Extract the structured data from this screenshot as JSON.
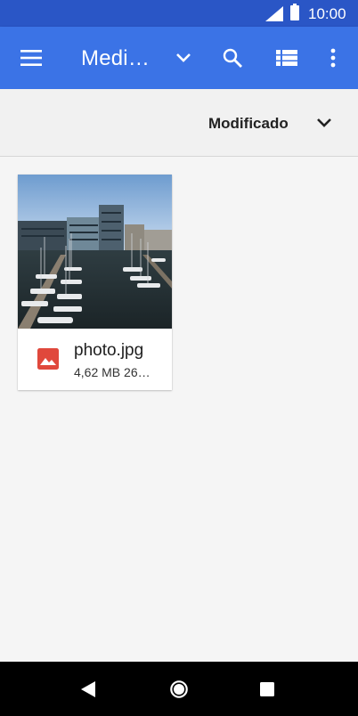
{
  "status_bar": {
    "time": "10:00"
  },
  "app_bar": {
    "title": "Medi…",
    "icons": [
      "menu-icon",
      "chevron-down-icon",
      "search-icon",
      "list-view-icon",
      "more-vert-icon"
    ]
  },
  "sort_bar": {
    "label": "Modificado"
  },
  "files": [
    {
      "name": "photo.jpg",
      "meta": "4,62 MB 26…",
      "icon": "image-icon",
      "icon_color": "#e0483c"
    }
  ],
  "colors": {
    "status_bar": "#2a56c6",
    "app_bar": "#3b73e6",
    "background": "#f5f5f5"
  },
  "nav_bar": {
    "icons": [
      "back-icon",
      "home-icon",
      "recents-icon"
    ]
  }
}
